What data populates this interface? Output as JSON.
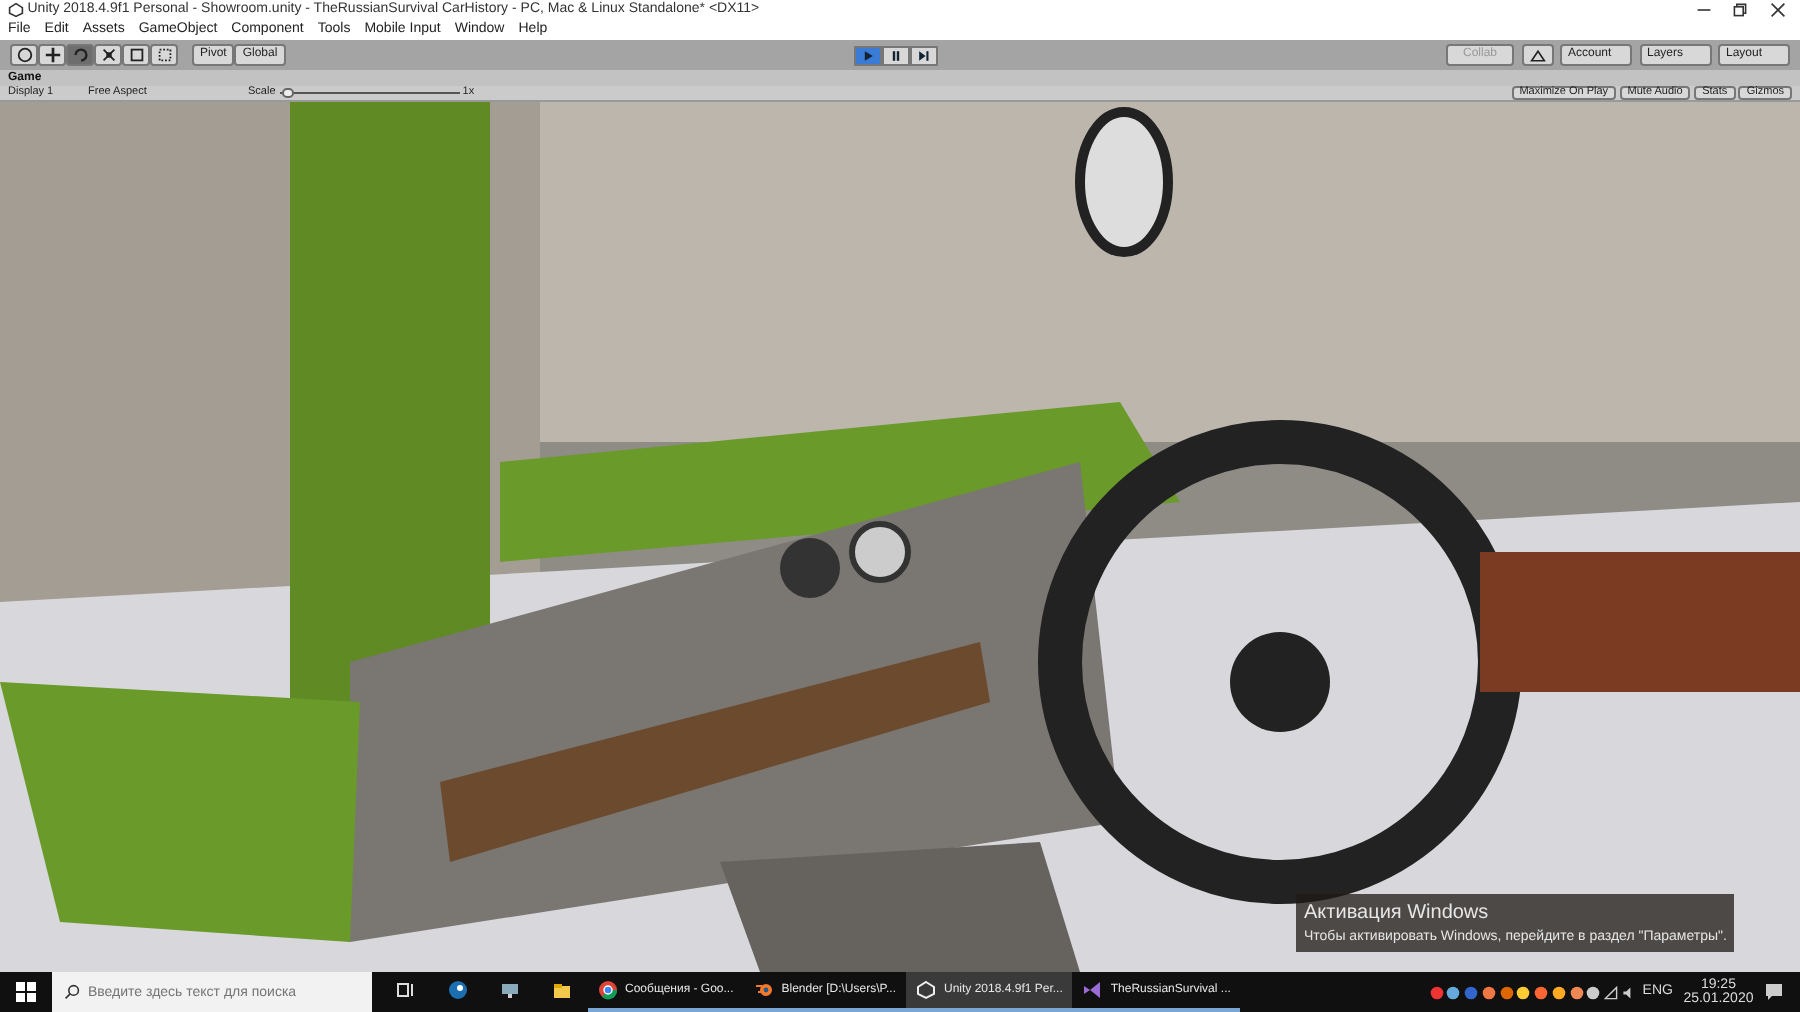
{
  "window": {
    "title": "Unity 2018.4.9f1 Personal - Showroom.unity - TheRussianSurvival CarHistory - PC, Mac & Linux Standalone* <DX11>"
  },
  "menu": [
    "File",
    "Edit",
    "Assets",
    "GameObject",
    "Component",
    "Tools",
    "Mobile Input",
    "Window",
    "Help"
  ],
  "toolbar": {
    "tools": [
      {
        "kind": "hand",
        "selected": false
      },
      {
        "kind": "move",
        "selected": false
      },
      {
        "kind": "rotate",
        "selected": true
      },
      {
        "kind": "scale",
        "selected": false
      },
      {
        "kind": "rect",
        "selected": false
      },
      {
        "kind": "transform",
        "selected": false
      }
    ],
    "pivot": "Pivot",
    "space": "Global",
    "playback": [
      {
        "kind": "play",
        "on": true
      },
      {
        "kind": "pause",
        "on": false
      },
      {
        "kind": "step",
        "on": false
      }
    ],
    "collab": {
      "label": "Collab",
      "disabled": true
    },
    "dropdowns": [
      "Account",
      "Layers",
      "Layout"
    ]
  },
  "game_panel": {
    "tab": "Game",
    "display": "Display 1",
    "aspect": "Free Aspect",
    "scale_label": "Scale",
    "scale": {
      "level": 0.02
    },
    "scale_value": "1x",
    "toggles": [
      {
        "label": "Maximize On Play",
        "on": false
      },
      {
        "label": "Mute Audio",
        "on": false
      },
      {
        "label": "Stats",
        "on": false
      },
      {
        "label": "Gizmos",
        "on": false
      }
    ]
  },
  "activation": {
    "title": "Активация Windows",
    "text": "Чтобы активировать Windows, перейдите в раздел \"Параметры\"."
  },
  "taskbar": {
    "search": {
      "placeholder": "Введите здесь текст для поиска"
    },
    "apps": [
      {
        "kind": "taskview",
        "selected": false,
        "running": false
      },
      {
        "kind": "steam",
        "selected": false,
        "running": false
      },
      {
        "kind": "monitor",
        "selected": false,
        "running": false
      },
      {
        "kind": "folder",
        "selected": false,
        "running": false
      },
      {
        "kind": "chrome",
        "label": "Сообщения - Goo...",
        "selected": false,
        "running": true
      },
      {
        "kind": "blender",
        "label": "Blender [D:\\Users\\P...",
        "selected": false,
        "running": true
      },
      {
        "kind": "unity",
        "label": "Unity 2018.4.9f1 Per...",
        "selected": true,
        "running": true
      },
      {
        "kind": "vs",
        "label": "TheRussianSurvival ...",
        "selected": false,
        "running": true
      }
    ],
    "language": "ENG",
    "time": "19:25",
    "date": "25.01.2020"
  }
}
